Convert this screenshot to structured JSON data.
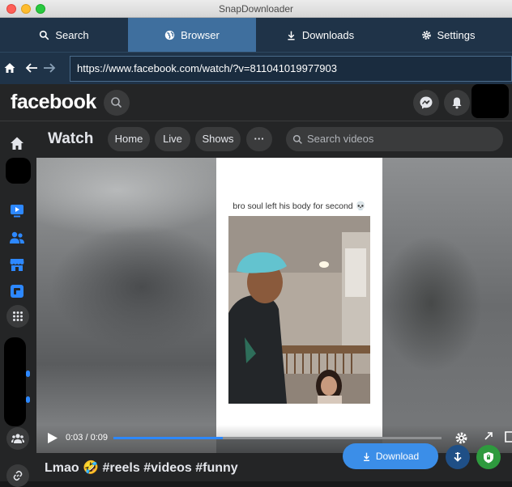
{
  "window": {
    "title": "SnapDownloader"
  },
  "app_tabs": [
    {
      "label": "Search",
      "icon": "search-icon"
    },
    {
      "label": "Browser",
      "icon": "globe-icon",
      "active": true
    },
    {
      "label": "Downloads",
      "icon": "download-icon"
    },
    {
      "label": "Settings",
      "icon": "gear-icon"
    }
  ],
  "browser": {
    "url": "https://www.facebook.com/watch/?v=811041019977903"
  },
  "facebook": {
    "logo": "facebook",
    "watch": {
      "title": "Watch",
      "pills": [
        "Home",
        "Live",
        "Shows"
      ],
      "more": "···",
      "search_placeholder": "Search videos"
    },
    "video": {
      "caption": "bro soul left his body for second 💀",
      "time": "0:03 / 0:09",
      "progress": 0.333
    },
    "post_title": "Lmao 🤣 #reels #videos #funny"
  },
  "download_button": {
    "label": "Download"
  },
  "colors": {
    "tab_bar": "#1f3348",
    "tab_active": "#3f6f9e",
    "fb_dark": "#242526",
    "accent_blue": "#3b8ee8",
    "shield_green": "#2e9a3e"
  }
}
